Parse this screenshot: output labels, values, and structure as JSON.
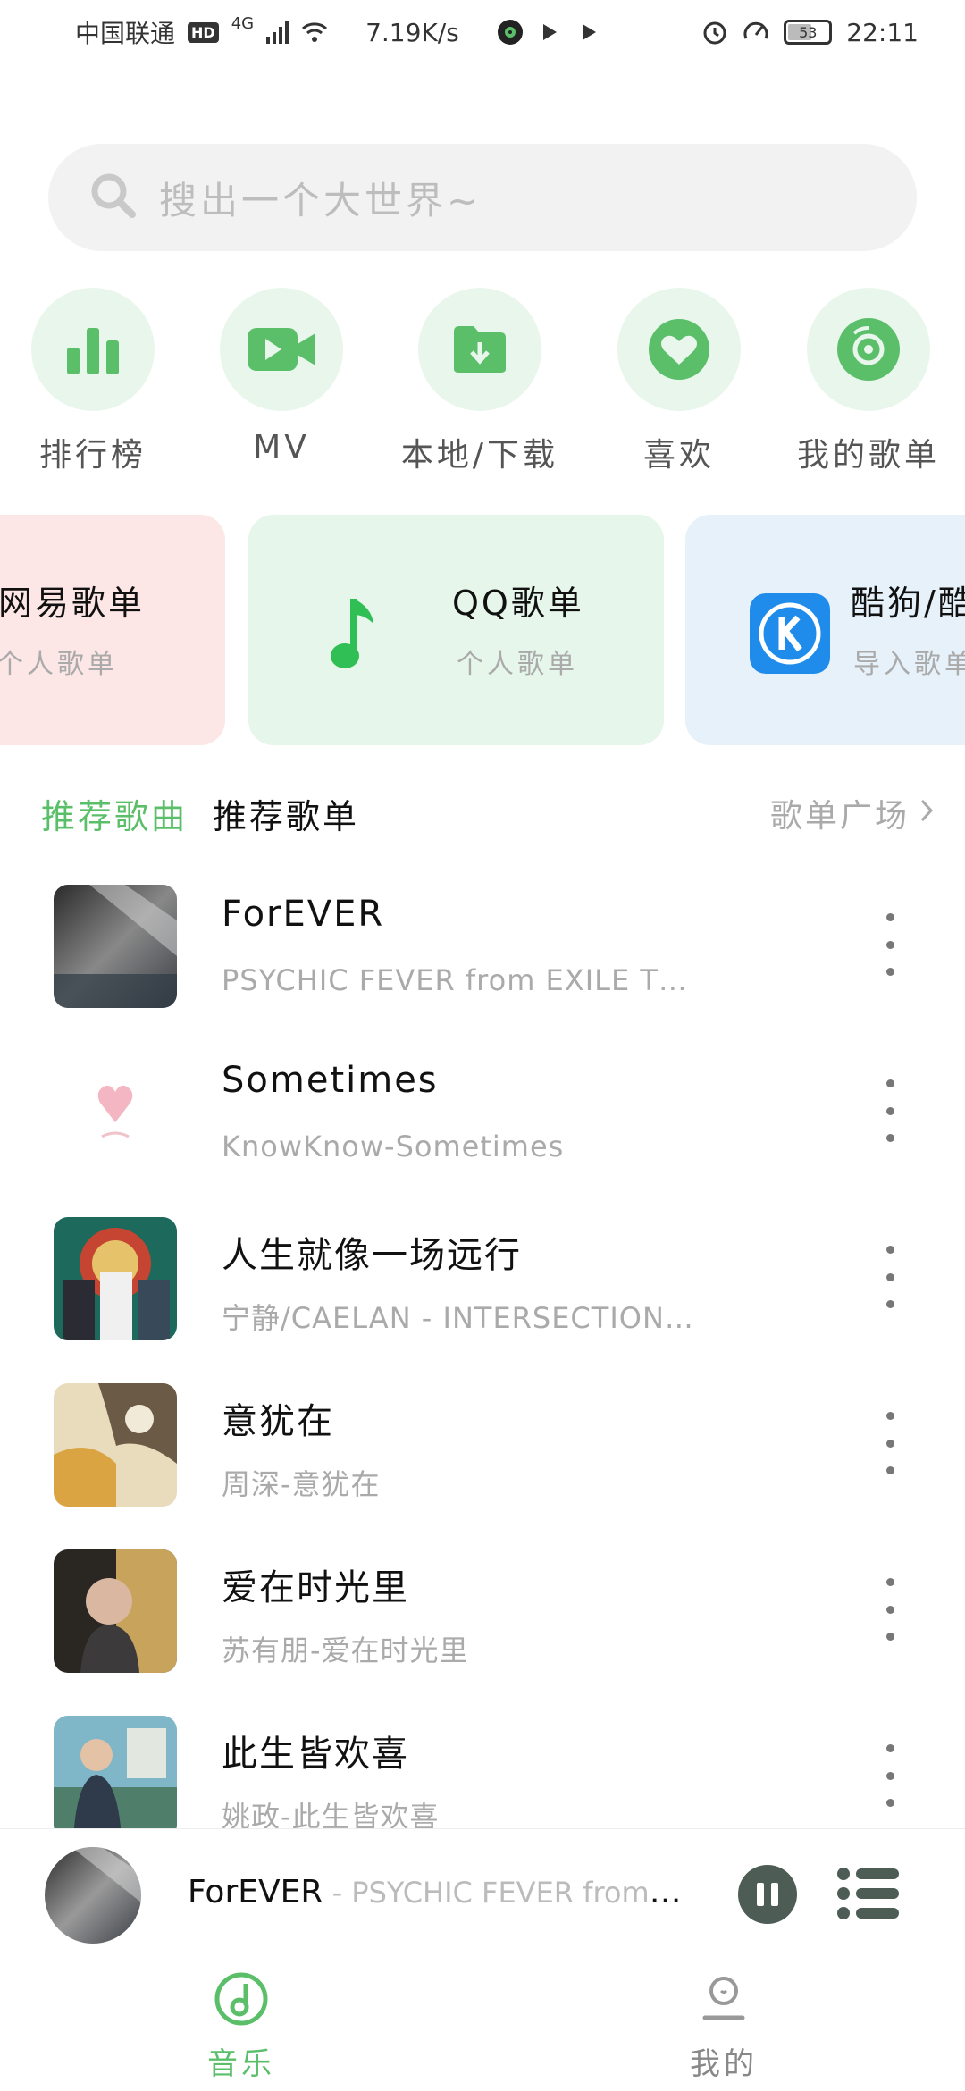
{
  "status_bar": {
    "carrier": "中国联通",
    "hd": "HD",
    "network": "4G",
    "speed": "7.19K/s",
    "battery": "53",
    "time": "22:11"
  },
  "search": {
    "placeholder": "搜出一个大世界~"
  },
  "quick_actions": [
    {
      "label": "排行榜",
      "icon": "bar-chart-icon"
    },
    {
      "label": "MV",
      "icon": "video-camera-icon"
    },
    {
      "label": "本地/下载",
      "icon": "download-folder-icon"
    },
    {
      "label": "喜欢",
      "icon": "heart-icon"
    },
    {
      "label": "我的歌单",
      "icon": "disc-icon"
    }
  ],
  "source_cards": [
    {
      "title": "网易歌单",
      "subtitle": "个人歌单",
      "color": "#fde6e6"
    },
    {
      "title": "QQ歌单",
      "subtitle": "个人歌单",
      "color": "#e6f6ea",
      "icon": "music-note-icon"
    },
    {
      "title": "酷狗/酷",
      "subtitle": "导入歌单",
      "color": "#e6f1fa",
      "icon": "kugou-logo-icon"
    }
  ],
  "section": {
    "tab_songs": "推荐歌曲",
    "tab_playlists": "推荐歌单",
    "more": "歌单广场"
  },
  "songs": [
    {
      "title": "ForEVER",
      "subtitle": "PSYCHIC FEVER from EXILE TRIBE - ForEVER"
    },
    {
      "title": "Sometimes",
      "subtitle": "KnowKnow-Sometimes"
    },
    {
      "title": "人生就像一场远行",
      "subtitle": "宁静/CAELAN - INTERSECTION-人生就像一场远行"
    },
    {
      "title": "意犹在",
      "subtitle": "周深-意犹在"
    },
    {
      "title": "爱在时光里",
      "subtitle": "苏有朋-爱在时光里"
    },
    {
      "title": "此生皆欢喜",
      "subtitle": "姚政-此生皆欢喜"
    }
  ],
  "mini_player": {
    "title": "ForEVER",
    "subtitle": " - PSYCHIC FEVER from EXILE TRIBE"
  },
  "bottom_nav": {
    "music": "音乐",
    "mine": "我的"
  },
  "colors": {
    "accent": "#5bbf6a",
    "icon_bg": "#e9f6ec"
  }
}
